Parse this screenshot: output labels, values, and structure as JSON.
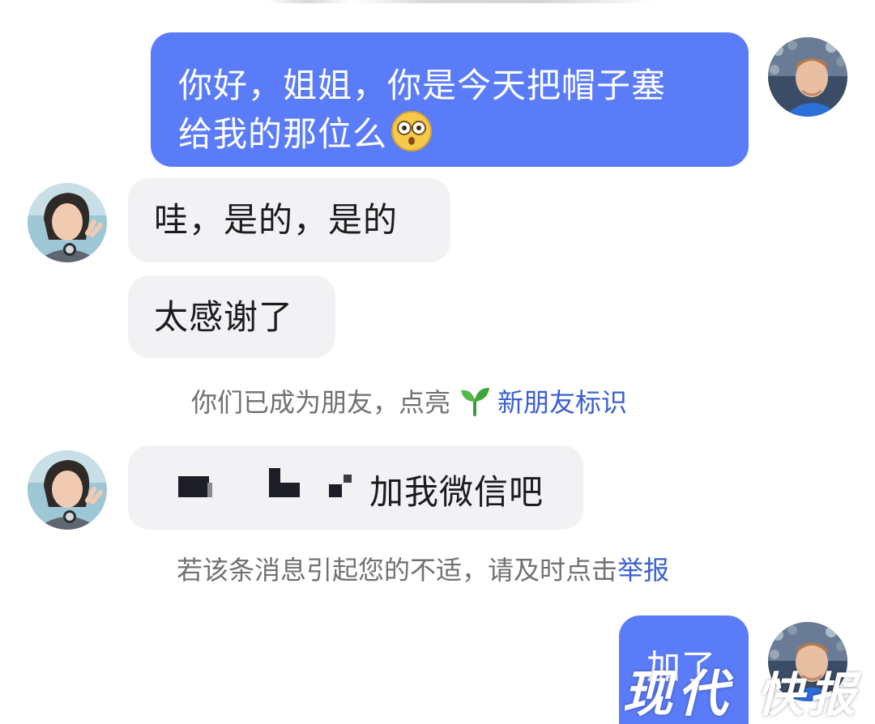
{
  "messages": {
    "m1": {
      "sender": "self",
      "line1": "你好，姐姐，你是今天把帽子塞",
      "line2": "给我的那位么",
      "emoji": "flushed-face-emoji"
    },
    "m2": {
      "sender": "other",
      "text": "哇，是的，是的"
    },
    "m3": {
      "sender": "other",
      "text": "太感谢了"
    },
    "m4": {
      "sender": "other",
      "redacted": true,
      "visible_text": "加我微信吧"
    },
    "m5": {
      "sender": "self",
      "text": "加了"
    }
  },
  "system_notes": {
    "friend_added": {
      "text": "你们已成为朋友，点亮",
      "icon": "sprout-icon",
      "link": "新朋友标识"
    },
    "report_notice": {
      "text": "若该条消息引起您的不适，请及时点击",
      "link": "举报"
    }
  },
  "watermark": {
    "text": "现代",
    "tail": "快报"
  },
  "colors": {
    "self_bubble": "#5b7cf8",
    "other_bubble": "#f2f2f5",
    "note_text": "#707075",
    "link": "#3a5fd0"
  }
}
